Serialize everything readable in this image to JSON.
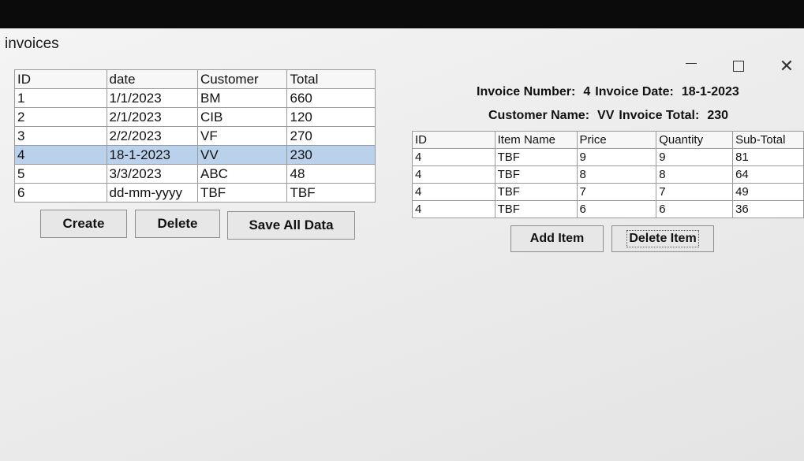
{
  "window": {
    "title": "invoices",
    "controls": {
      "minimize_icon": "minimize-icon",
      "maximize_icon": "maximize-icon",
      "close_icon": "close-icon",
      "close_glyph": "✕"
    }
  },
  "invoice_table": {
    "columns": [
      "ID",
      "date",
      "Customer",
      "Total"
    ],
    "rows": [
      [
        "1",
        "1/1/2023",
        "BM",
        "660"
      ],
      [
        "2",
        "2/1/2023",
        "CIB",
        "120"
      ],
      [
        "3",
        "2/2/2023",
        "VF",
        "270"
      ],
      [
        "4",
        "18-1-2023",
        "VV",
        "230"
      ],
      [
        "5",
        "3/3/2023",
        "ABC",
        "48"
      ],
      [
        "6",
        "dd-mm-yyyy",
        "TBF",
        "TBF"
      ]
    ],
    "selected_row": 4,
    "selection_color": "#b9d1ea"
  },
  "buttons": {
    "create": "Create",
    "delete": "Delete",
    "save_all": "Save All Data",
    "add_item": "Add Item",
    "delete_item": "Delete Item"
  },
  "invoice_details": {
    "number_label": "Invoice Number:",
    "number_value": "4",
    "date_label": "Invoice Date:",
    "date_value": "18-1-2023",
    "customer_label": "Customer Name:",
    "customer_value": "VV",
    "total_label": "Invoice Total:",
    "total_value": "230"
  },
  "items_table": {
    "columns": [
      "ID",
      "Item Name",
      "Price",
      "Quantity",
      "Sub-Total"
    ],
    "rows": [
      [
        "4",
        "TBF",
        "9",
        "9",
        "81"
      ],
      [
        "4",
        "TBF",
        "8",
        "8",
        "64"
      ],
      [
        "4",
        "TBF",
        "7",
        "7",
        "49"
      ],
      [
        "4",
        "TBF",
        "6",
        "6",
        "36"
      ]
    ]
  }
}
